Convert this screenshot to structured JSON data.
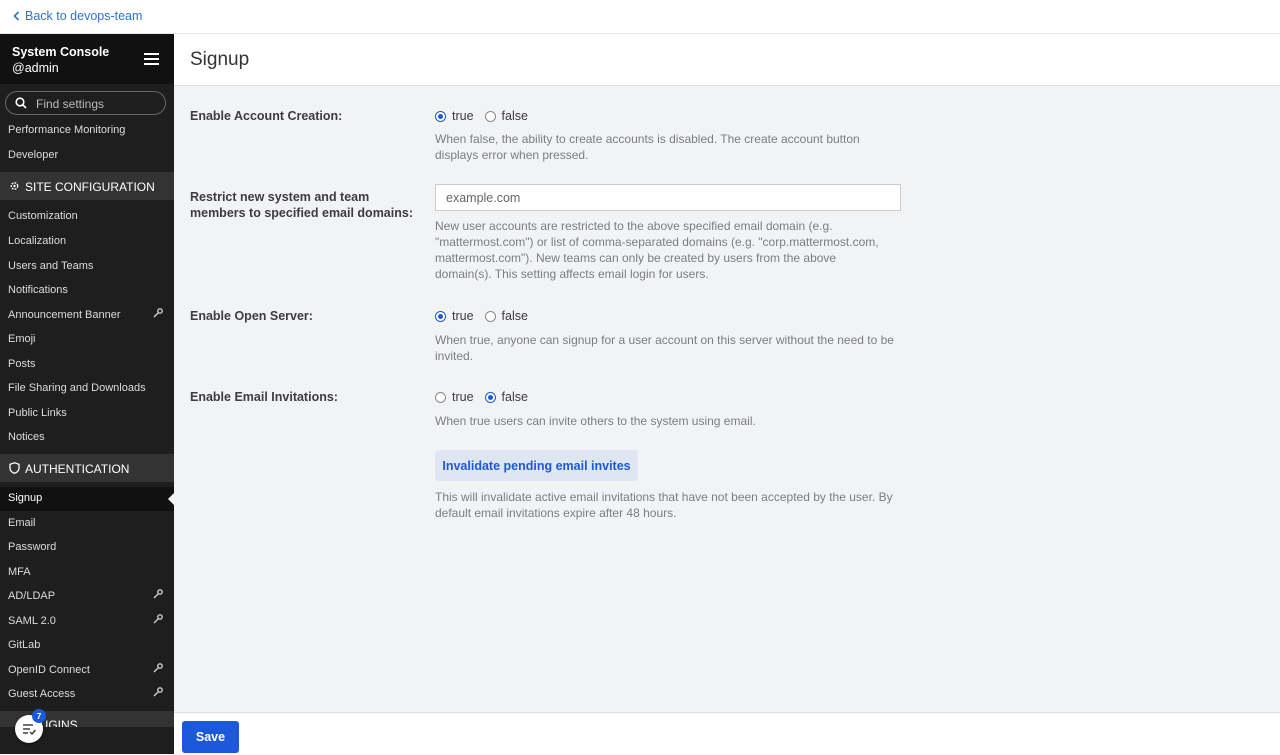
{
  "back_link": "Back to devops-team",
  "sidebar": {
    "title": "System Console",
    "user": "@admin",
    "search_placeholder": "Find settings",
    "items_top": [
      {
        "label": "Performance Monitoring"
      },
      {
        "label": "Developer"
      }
    ],
    "section_site": "SITE CONFIGURATION",
    "items_site": [
      {
        "label": "Customization"
      },
      {
        "label": "Localization"
      },
      {
        "label": "Users and Teams"
      },
      {
        "label": "Notifications"
      },
      {
        "label": "Announcement Banner",
        "license": true
      },
      {
        "label": "Emoji"
      },
      {
        "label": "Posts"
      },
      {
        "label": "File Sharing and Downloads"
      },
      {
        "label": "Public Links"
      },
      {
        "label": "Notices"
      }
    ],
    "section_auth": "AUTHENTICATION",
    "items_auth": [
      {
        "label": "Signup",
        "active": true
      },
      {
        "label": "Email"
      },
      {
        "label": "Password"
      },
      {
        "label": "MFA"
      },
      {
        "label": "AD/LDAP",
        "license": true
      },
      {
        "label": "SAML 2.0",
        "license": true
      },
      {
        "label": "GitLab"
      },
      {
        "label": "OpenID Connect",
        "license": true
      },
      {
        "label": "Guest Access",
        "license": true
      }
    ],
    "section_plugins": "PLUGINS",
    "notification_count": "7"
  },
  "page": {
    "title": "Signup",
    "account_creation": {
      "label": "Enable Account Creation:",
      "true_label": "true",
      "false_label": "false",
      "value": "true",
      "help": "When false, the ability to create accounts is disabled. The create account button displays error when pressed."
    },
    "restrict_domains": {
      "label": "Restrict new system and team members to specified email domains:",
      "placeholder": "example.com",
      "help": "New user accounts are restricted to the above specified email domain (e.g. \"mattermost.com\") or list of comma-separated domains (e.g. \"corp.mattermost.com, mattermost.com\"). New teams can only be created by users from the above domain(s). This setting affects email login for users."
    },
    "open_server": {
      "label": "Enable Open Server:",
      "true_label": "true",
      "false_label": "false",
      "value": "true",
      "help": "When true, anyone can signup for a user account on this server without the need to be invited."
    },
    "email_invitations": {
      "label": "Enable Email Invitations:",
      "true_label": "true",
      "false_label": "false",
      "value": "false",
      "help": "When true users can invite others to the system using email."
    },
    "invalidate_button": "Invalidate pending email invites",
    "invalidate_help": "This will invalidate active email invitations that have not been accepted by the user. By default email invitations expire after 48 hours."
  },
  "footer": {
    "save_label": "Save"
  },
  "colors": {
    "accent": "#1c58d9",
    "sidebar_bg": "#1e1e1e",
    "main_bg": "#f2f3f5"
  }
}
